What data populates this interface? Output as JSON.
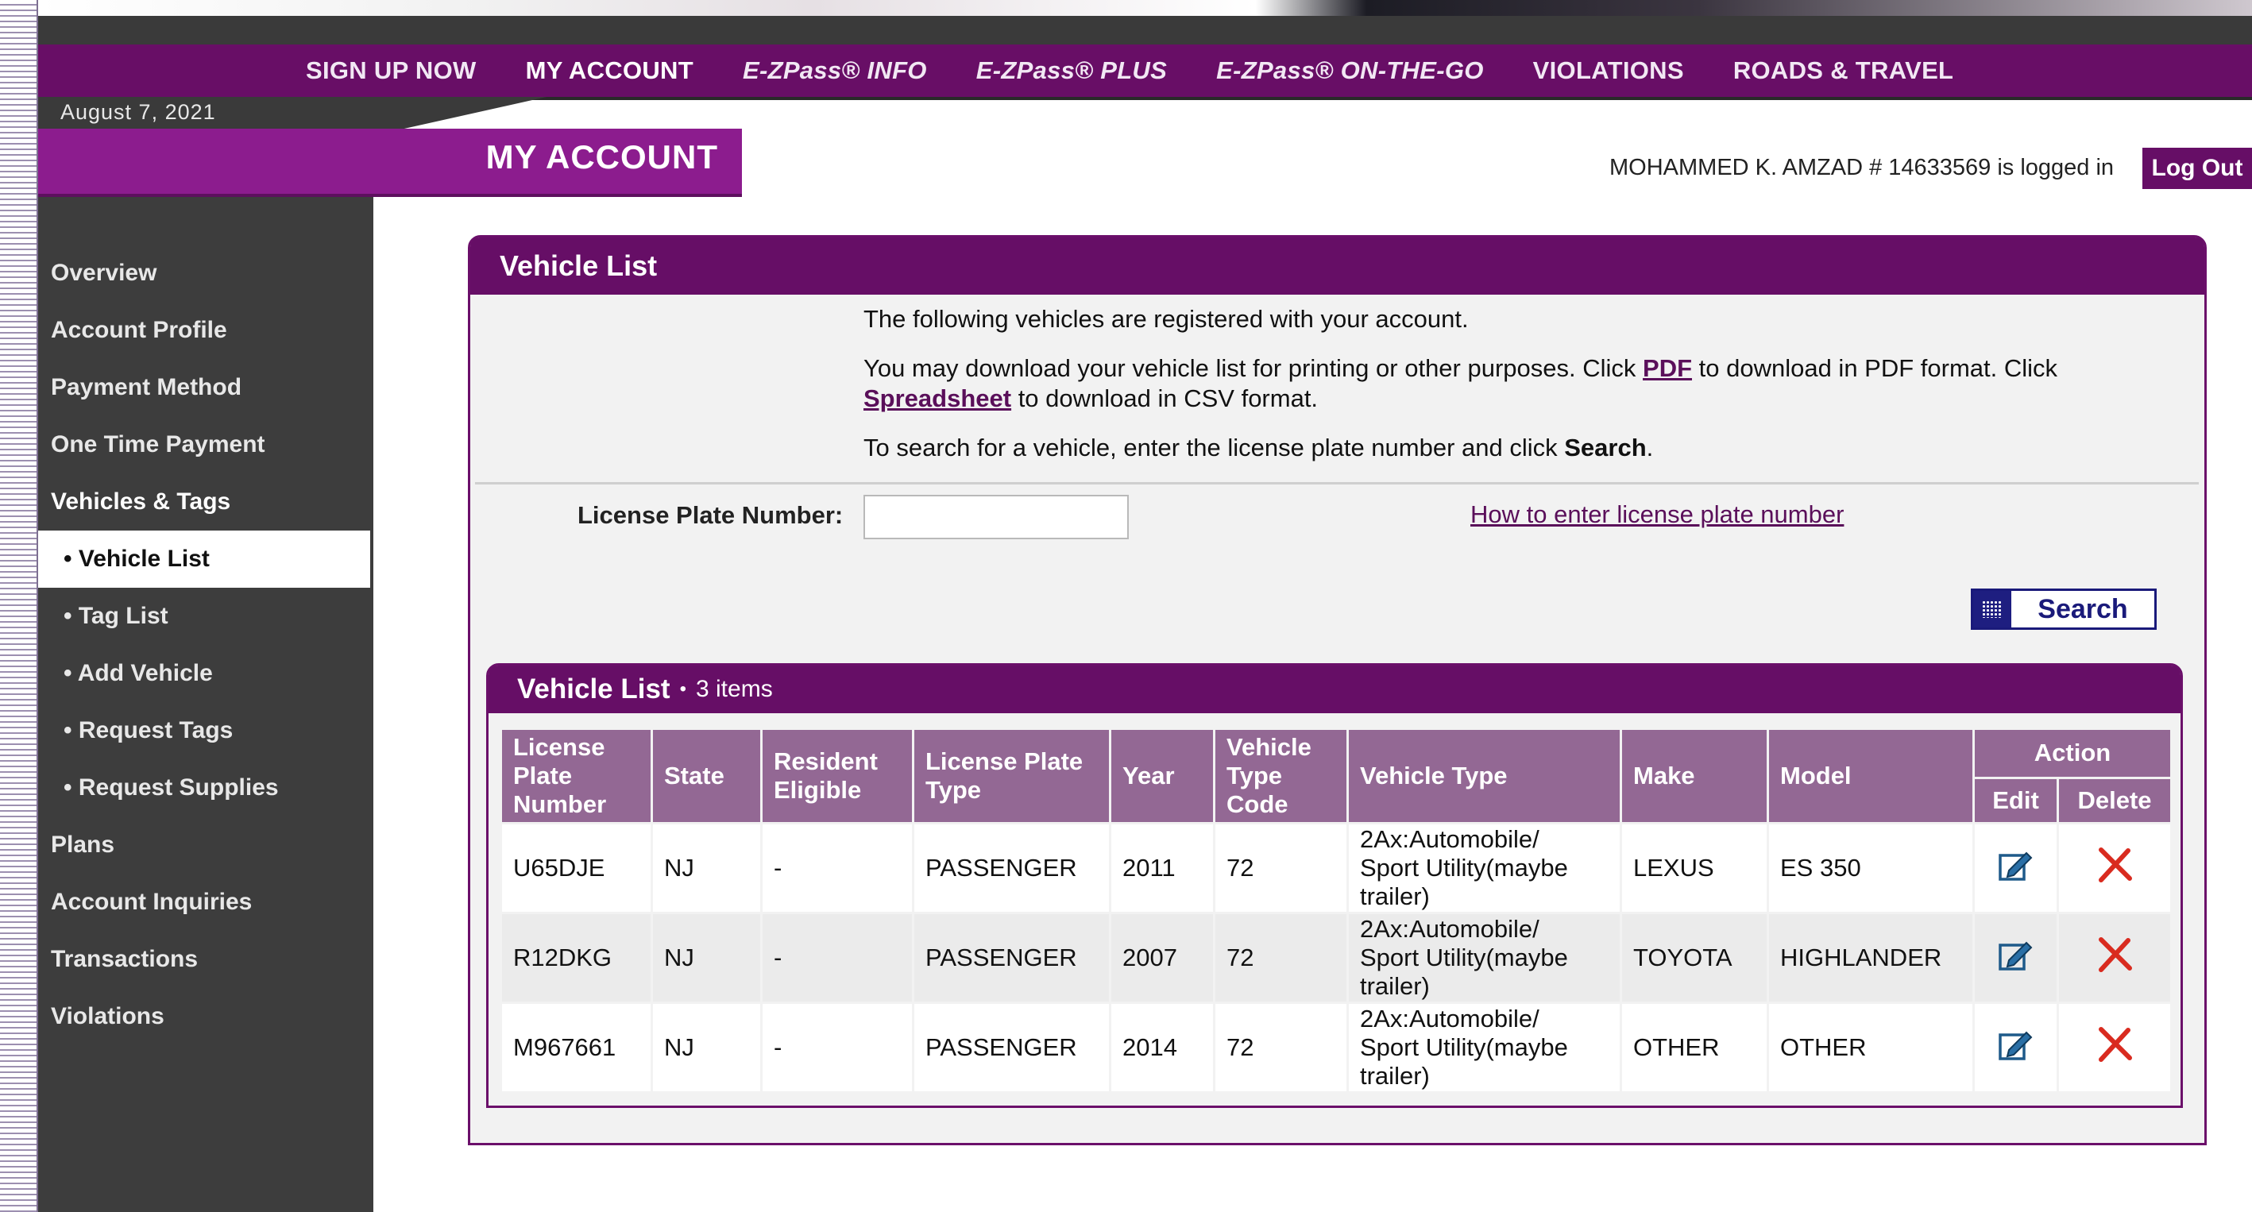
{
  "nav": {
    "items": [
      "SIGN UP NOW",
      "MY ACCOUNT",
      "E-ZPass® INFO",
      "E-ZPass® PLUS",
      "E-ZPass® ON-THE-GO",
      "VIOLATIONS",
      "ROADS & TRAVEL"
    ]
  },
  "date": "August 7, 2021",
  "banner_title": "MY ACCOUNT",
  "session": {
    "logged_in_text": "MOHAMMED K. AMZAD # 14633569 is logged in",
    "logout_label": "Log Out"
  },
  "sidebar": {
    "items": [
      "Overview",
      "Account Profile",
      "Payment Method",
      "One Time Payment",
      "Vehicles & Tags",
      "• Vehicle List",
      "• Tag List",
      "• Add Vehicle",
      "• Request Tags",
      "• Request Supplies",
      "Plans",
      "Account Inquiries",
      "Transactions",
      "Violations"
    ]
  },
  "panel": {
    "title": "Vehicle List",
    "intro_line1": "The following vehicles are registered with your account.",
    "intro_line2_a": "You may download your vehicle list for printing or other purposes. Click ",
    "pdf_link": "PDF",
    "intro_line2_b": " to download in PDF format. Click ",
    "spreadsheet_link": "Spreadsheet",
    "intro_line2_c": " to download in CSV format.",
    "intro_line3_a": "To search for a vehicle, enter the license plate number and click ",
    "intro_line3_bold": "Search",
    "intro_line3_c": ".",
    "plate_label": "License Plate Number:",
    "plate_value": "",
    "how_link": "How to enter license plate number",
    "search_label": "Search"
  },
  "list": {
    "title": "Vehicle List",
    "dot": "•",
    "count": "3 items",
    "headers": {
      "plate": [
        "License",
        "Plate",
        "Number"
      ],
      "state": "State",
      "resident": [
        "Resident",
        "Eligible"
      ],
      "plate_type": [
        "License Plate",
        "Type"
      ],
      "year": "Year",
      "type_code": [
        "Vehicle",
        "Type",
        "Code"
      ],
      "vehicle_type": "Vehicle Type",
      "make": "Make",
      "model": "Model",
      "action": "Action",
      "edit": "Edit",
      "delete": "Delete"
    },
    "rows": [
      {
        "plate": "U65DJE",
        "state": "NJ",
        "resident": "-",
        "plate_type": "PASSENGER",
        "year": "2011",
        "type_code": "72",
        "vehicle_type": [
          "2Ax:Automobile/",
          "Sport Utility(maybe",
          "trailer)"
        ],
        "make": "LEXUS",
        "model": "ES 350"
      },
      {
        "plate": "R12DKG",
        "state": "NJ",
        "resident": "-",
        "plate_type": "PASSENGER",
        "year": "2007",
        "type_code": "72",
        "vehicle_type": [
          "2Ax:Automobile/",
          "Sport Utility(maybe",
          "trailer)"
        ],
        "make": "TOYOTA",
        "model": "HIGHLANDER"
      },
      {
        "plate": "M967661",
        "state": "NJ",
        "resident": "-",
        "plate_type": "PASSENGER",
        "year": "2014",
        "type_code": "72",
        "vehicle_type": [
          "2Ax:Automobile/",
          "Sport Utility(maybe",
          "trailer)"
        ],
        "make": "OTHER",
        "model": "OTHER"
      }
    ]
  },
  "icons": {
    "edit": "edit-pencil-icon",
    "delete": "delete-x-icon",
    "search": "search-grid-icon"
  },
  "colors": {
    "brand_purple": "#660e66",
    "banner_purple": "#8c1c8e",
    "header_mauve": "#936894",
    "sidebar_dark": "#3d3d3d",
    "link": "#5a0f5a",
    "delete_red": "#d92b1f",
    "edit_blue": "#1e5a8a"
  }
}
